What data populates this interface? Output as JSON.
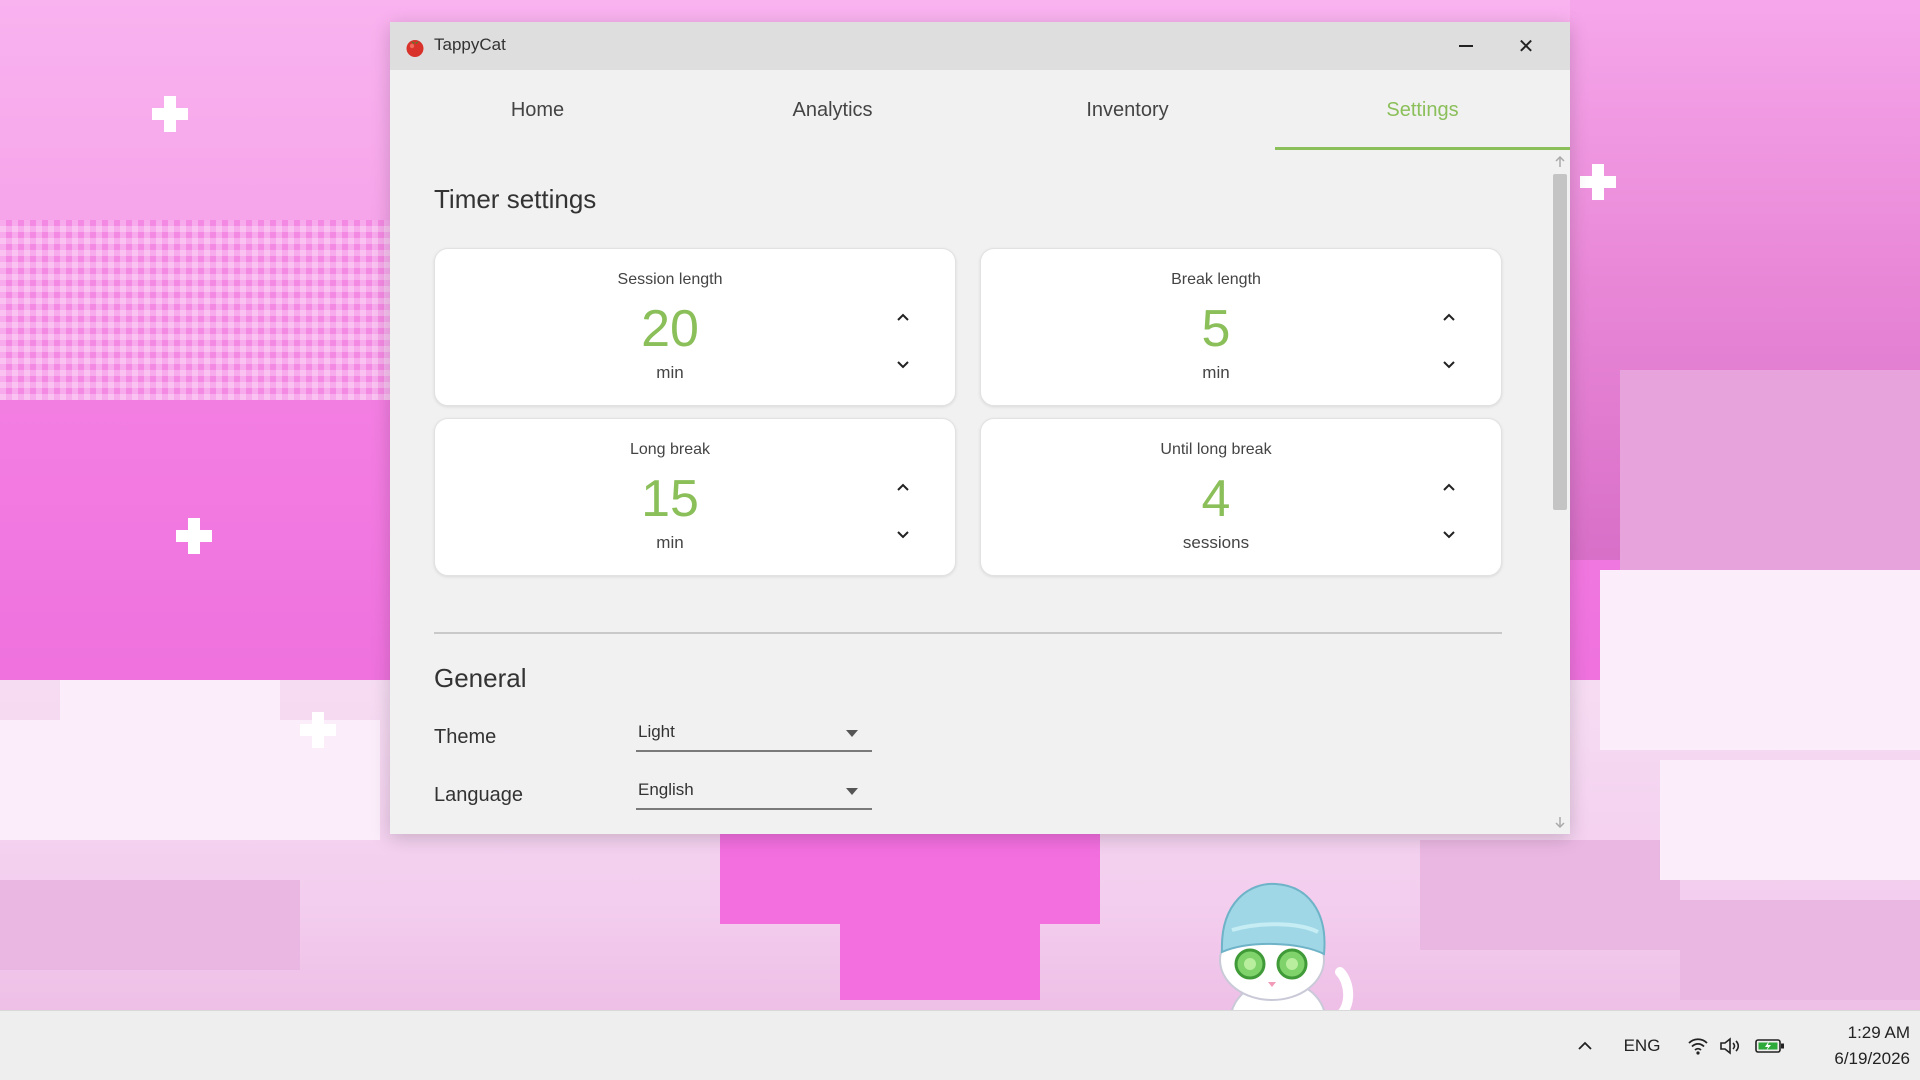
{
  "window": {
    "title": "TappyCat",
    "minimize_glyph": "–",
    "close_glyph": "✕"
  },
  "tabs": [
    {
      "label": "Home",
      "active": false
    },
    {
      "label": "Analytics",
      "active": false
    },
    {
      "label": "Inventory",
      "active": false
    },
    {
      "label": "Settings",
      "active": true
    }
  ],
  "timer_settings": {
    "title": "Timer settings",
    "cards": [
      {
        "label": "Session length",
        "value": "20",
        "unit": "min"
      },
      {
        "label": "Break length",
        "value": "5",
        "unit": "min"
      },
      {
        "label": "Long break",
        "value": "15",
        "unit": "min"
      },
      {
        "label": "Until long break",
        "value": "4",
        "unit": "sessions"
      }
    ]
  },
  "general": {
    "title": "General",
    "theme_label": "Theme",
    "theme_value": "Light",
    "language_label": "Language",
    "language_value": "English"
  },
  "taskbar": {
    "language": "ENG",
    "time": "1:29 AM",
    "date": "6/19/2026"
  },
  "colors": {
    "accent": "#8bbf5a",
    "window_bg": "#f1f1f1",
    "titlebar_bg": "#dedede",
    "wallpaper_pink": "#f37ee2"
  },
  "icons": {
    "app": "tomato-icon",
    "stepper_up": "chevron-up-icon",
    "stepper_down": "chevron-down-icon",
    "dropdown": "caret-down-icon",
    "tray": [
      "chevron-up-icon",
      "wifi-icon",
      "speaker-icon",
      "battery-icon"
    ]
  }
}
